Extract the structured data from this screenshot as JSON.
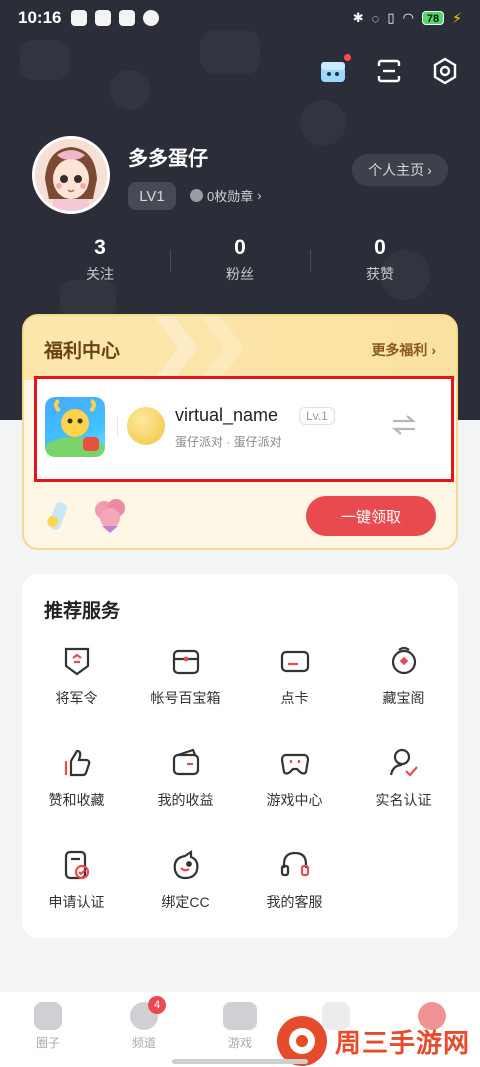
{
  "status_bar": {
    "time": "10:16",
    "battery": "78"
  },
  "profile": {
    "username": "多多蛋仔",
    "level": "LV1",
    "medals": "0枚勋章",
    "homepage_button": "个人主页"
  },
  "stats": [
    {
      "value": "3",
      "label": "关注"
    },
    {
      "value": "0",
      "label": "粉丝"
    },
    {
      "value": "0",
      "label": "获赞"
    }
  ],
  "welfare": {
    "title": "福利中心",
    "more": "更多福利",
    "role_name": "virtual_name",
    "role_level": "Lv.1",
    "role_sub": "蛋仔派对 · 蛋仔派对",
    "claim_button": "一键领取"
  },
  "services": {
    "title": "推荐服务",
    "items": [
      {
        "label": "将军令",
        "icon": "shield-token-icon"
      },
      {
        "label": "帐号百宝箱",
        "icon": "treasure-box-icon"
      },
      {
        "label": "点卡",
        "icon": "card-icon"
      },
      {
        "label": "藏宝阁",
        "icon": "treasure-pavilion-icon"
      },
      {
        "label": "赞和收藏",
        "icon": "thumbs-up-icon"
      },
      {
        "label": "我的收益",
        "icon": "wallet-icon"
      },
      {
        "label": "游戏中心",
        "icon": "gamepad-icon"
      },
      {
        "label": "实名认证",
        "icon": "user-verify-icon"
      },
      {
        "label": "申请认证",
        "icon": "document-verify-icon"
      },
      {
        "label": "绑定CC",
        "icon": "cc-bird-icon"
      },
      {
        "label": "我的客服",
        "icon": "headset-icon"
      }
    ]
  },
  "bottom_nav": [
    {
      "label": "圈子",
      "icon": "circle-god-icon"
    },
    {
      "label": "频道",
      "icon": "channel-icon",
      "badge": "4"
    },
    {
      "label": "游戏",
      "icon": "gamepad-nav-icon"
    },
    {
      "label": "",
      "icon": "hidden-icon"
    },
    {
      "label": "",
      "icon": "hidden-icon-2"
    }
  ],
  "watermark": {
    "text": "周三手游网"
  },
  "colors": {
    "accent": "#e84a4f",
    "header_bg": "#2b2e38",
    "welfare_border": "#f7d98a",
    "highlight_box": "#e3161c"
  }
}
